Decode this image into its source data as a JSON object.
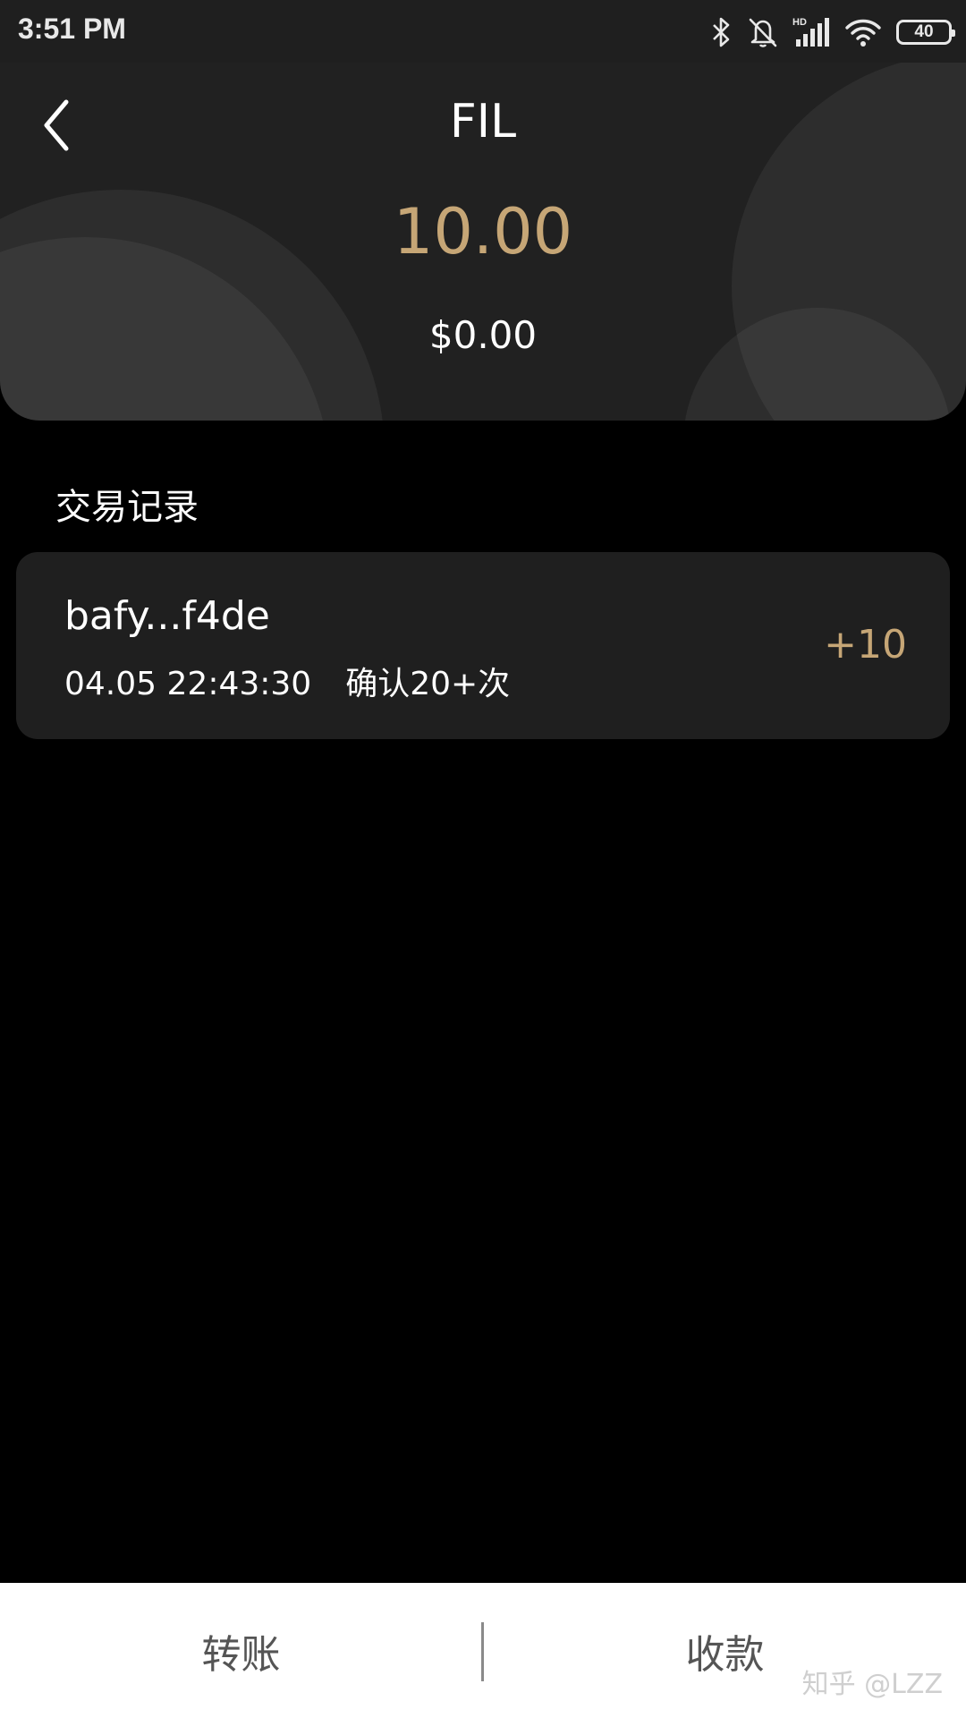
{
  "status_bar": {
    "time": "3:51 PM",
    "battery": "40",
    "icons": [
      "bluetooth-icon",
      "mute-bell-icon",
      "hd-signal-icon",
      "wifi-icon",
      "battery-icon"
    ]
  },
  "header": {
    "title": "FIL",
    "balance": "10.00",
    "fiat_value": "$0.00",
    "back_icon": "chevron-left-icon"
  },
  "transactions": {
    "title": "交易记录",
    "items": [
      {
        "hash": "bafy...f4de",
        "datetime": "04.05 22:43:30",
        "confirmations": "确认20+次",
        "amount": "+10"
      }
    ]
  },
  "bottom_bar": {
    "transfer_label": "转账",
    "receive_label": "收款",
    "watermark": "知乎 @LZZ"
  },
  "colors": {
    "accent_gold": "#c6a676",
    "background": "#000000",
    "card": "#1f1f1f",
    "header": "#212121"
  }
}
